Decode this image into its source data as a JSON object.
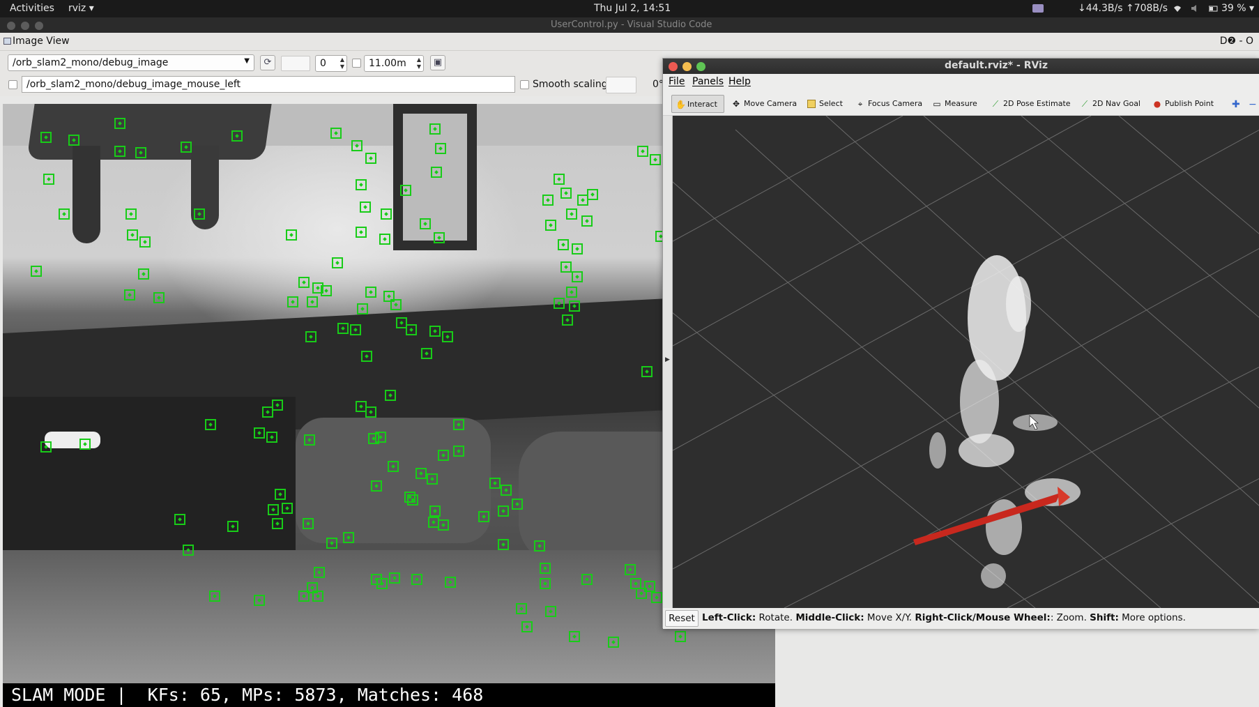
{
  "topbar": {
    "activities": "Activities",
    "app_menu": "rviz ▾",
    "clock": "Thu Jul  2, 14:51",
    "network": "↓44.3B/s ↑708B/s",
    "battery": "39 % ▾"
  },
  "vscode_window": {
    "title": "UserControl.py - Visual Studio Code"
  },
  "image_view": {
    "plugin_title": "Image View",
    "header_right": "D❷ - O",
    "topic": "/orb_slam2_mono/debug_image",
    "spin_value": "0",
    "max_range": "11.00m",
    "mouse_topic": "/orb_slam2_mono/debug_image_mouse_left",
    "smooth_scaling_label": "Smooth scaling",
    "rotation_value": "0°",
    "overlay_text": "SLAM MODE |  KFs: 65, MPs: 5873, Matches: 468"
  },
  "rviz": {
    "title": "default.rviz* - RViz",
    "menu": [
      "File",
      "Panels",
      "Help"
    ],
    "tools": [
      {
        "label": "Interact",
        "icon": "hand-icon"
      },
      {
        "label": "Move Camera",
        "icon": "move-camera-icon"
      },
      {
        "label": "Select",
        "icon": "select-icon"
      },
      {
        "label": "Focus Camera",
        "icon": "focus-camera-icon"
      },
      {
        "label": "Measure",
        "icon": "ruler-icon"
      },
      {
        "label": "2D Pose Estimate",
        "icon": "pose-arrow-icon"
      },
      {
        "label": "2D Nav Goal",
        "icon": "nav-goal-icon"
      },
      {
        "label": "Publish Point",
        "icon": "pin-icon"
      }
    ],
    "reset_label": "Reset",
    "hint": {
      "k1": "Left-Click:",
      "v1": " Rotate. ",
      "k2": "Middle-Click:",
      "v2": " Move X/Y. ",
      "k3": "Right-Click/Mouse Wheel:",
      "v3": ": Zoom. ",
      "k4": "Shift:",
      "v4": " More options."
    }
  },
  "colors": {
    "keypoint_green": "#18cc18",
    "rviz_background": "#2e2e2e",
    "pose_arrow_red": "#c8281e"
  }
}
